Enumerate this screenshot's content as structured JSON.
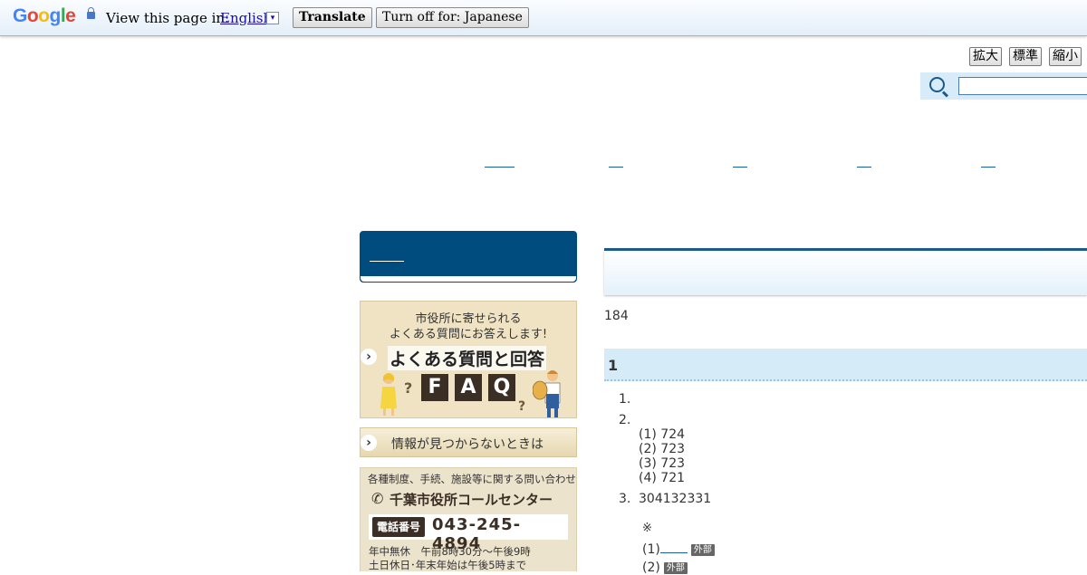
{
  "translate_bar": {
    "logo_letters": [
      "G",
      "o",
      "o",
      "g",
      "l",
      "e"
    ],
    "prompt": "View this page in:",
    "language": "English",
    "dropdown_glyph": "▾",
    "translate_label": "Translate",
    "turn_off_label": "Turn off for: Japanese"
  },
  "font_size": {
    "enlarge": "拡大",
    "standard": "標準",
    "shrink": "縮小"
  },
  "search": {
    "value": ""
  },
  "faq_banner": {
    "line1": "市役所に寄せられる",
    "line2": "よくある質問にお答えします!",
    "title": "よくある質問と回答",
    "tiles": [
      "F",
      "A",
      "Q"
    ],
    "question_mark": "?"
  },
  "notfound_banner": {
    "label": "情報が見つからないときは"
  },
  "call_center": {
    "heading": "各種制度、手続、施設等に関する問い合わせ",
    "name": "千葉市役所コールセンター",
    "phone_tag": "電話番号",
    "phone": "043-245-4894",
    "hours1": "年中無休　午前8時30分～午後9時",
    "hours2": "土日休日･年末年始は午後5時まで"
  },
  "main": {
    "lead": "184",
    "section_heading": "1",
    "list": [
      {
        "num": "1.",
        "text": ""
      },
      {
        "num": "2.",
        "text": "",
        "sub": [
          "(1) 724",
          "(2) 723",
          "(3) 723",
          "(4) 721"
        ]
      },
      {
        "num": "3.",
        "text": "304132331"
      }
    ],
    "note_mark": "※",
    "external": [
      {
        "num": "(1)",
        "badge": "外部"
      },
      {
        "num": "(2)",
        "badge": "外部"
      }
    ]
  },
  "colors": {
    "primary": "#004c7e",
    "accent_bg": "#d6ebf8",
    "brown": "#3b2e24"
  }
}
